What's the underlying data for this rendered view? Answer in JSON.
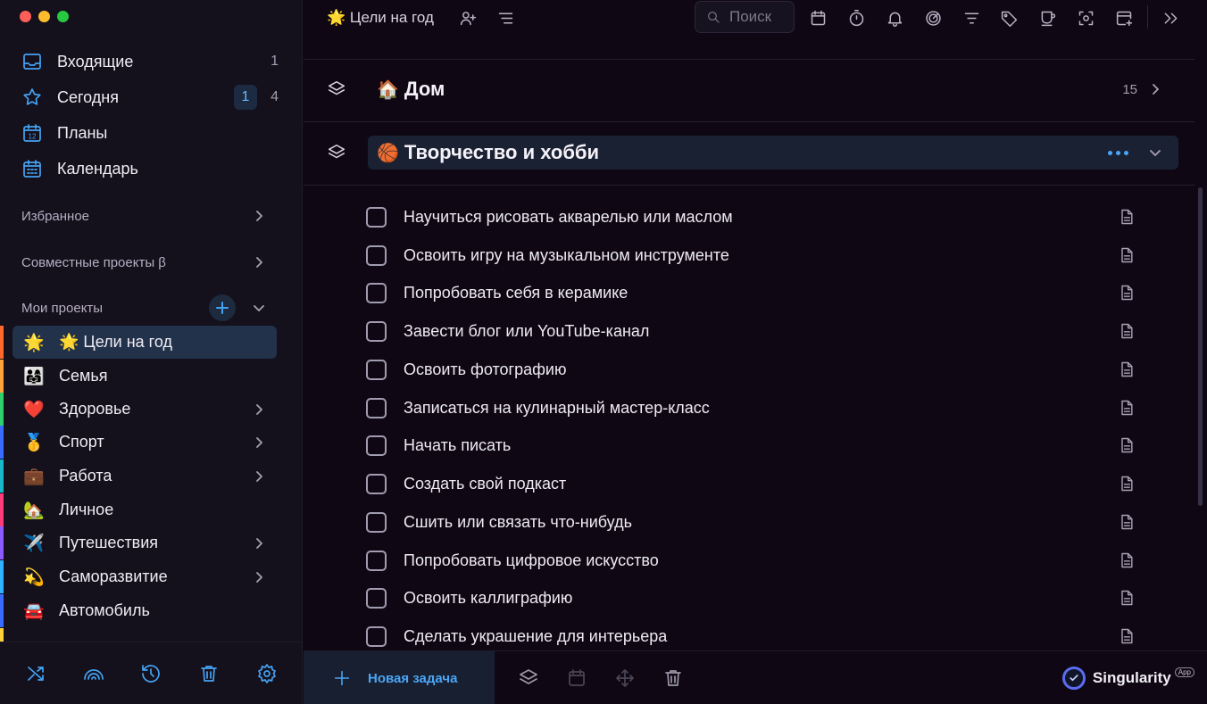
{
  "window": {
    "traffic_lights": [
      "#ff5f57",
      "#febc2e",
      "#28c840"
    ]
  },
  "sidebar": {
    "nav": [
      {
        "label": "Входящие",
        "icon": "inbox-icon",
        "count": "1"
      },
      {
        "label": "Сегодня",
        "icon": "star-icon",
        "badge": "1",
        "count": "4"
      },
      {
        "label": "Планы",
        "icon": "calendar-12-icon",
        "icon_text": "12"
      },
      {
        "label": "Календарь",
        "icon": "calendar-grid-icon"
      }
    ],
    "favorites_label": "Избранное",
    "shared_label": "Совместные проекты β",
    "my_projects_label": "Мои проекты",
    "projects": [
      {
        "emoji": "🌟",
        "label": "🌟 Цели на год",
        "color": "#ff6a2a",
        "active": true
      },
      {
        "emoji": "👨‍👩‍👧",
        "label": "Семья",
        "color": "#ffa23a"
      },
      {
        "emoji": "❤️",
        "label": "Здоровье",
        "color": "#2fcf6b",
        "has_children": true
      },
      {
        "emoji": "🥇",
        "label": "Спорт",
        "color": "#3a6bff",
        "has_children": true
      },
      {
        "emoji": "💼",
        "label": "Работа",
        "color": "#19b8c9",
        "has_children": true
      },
      {
        "emoji": "🏡",
        "label": "Личное",
        "color": "#ff3b7a"
      },
      {
        "emoji": "✈️",
        "label": "Путешествия",
        "color": "#8a5bff",
        "has_children": true
      },
      {
        "emoji": "💫",
        "label": "Саморазвитие",
        "color": "#2fb3ff",
        "has_children": true
      },
      {
        "emoji": "🚘",
        "label": "Автомобиль",
        "color": "#3a6bff"
      }
    ],
    "bottom_icons": [
      "shuffle-icon",
      "rainbow-icon",
      "history-icon",
      "trash-icon",
      "gear-icon"
    ]
  },
  "toolbar": {
    "title": "🌟 Цели на год",
    "search_placeholder": "Поиск",
    "icons": [
      "calendar-icon",
      "timer-icon",
      "bell-icon",
      "focus-icon",
      "filter-icon",
      "tag-icon",
      "cup-icon",
      "scan-icon",
      "add-window-icon",
      "double-chevron-right-icon"
    ]
  },
  "groups": [
    {
      "emoji": "🏠",
      "title": "Дом",
      "count": "15",
      "expanded": false
    },
    {
      "emoji": "🏀",
      "title": "Творчество и хобби",
      "expanded": true
    }
  ],
  "tasks": [
    "Научиться рисовать акварелью или маслом",
    "Освоить игру на музыкальном инструменте",
    "Попробовать себя в керамике",
    "Завести блог или YouTube-канал",
    "Освоить фотографию",
    "Записаться на кулинарный мастер-класс",
    "Начать писать",
    "Создать свой подкаст",
    "Сшить или связать что-нибудь",
    "Попробовать цифровое искусство",
    "Освоить каллиграфию",
    "Сделать украшение для интерьера"
  ],
  "bottom_bar": {
    "new_task_label": "Новая задача",
    "icons": [
      "layers-icon",
      "calendar-icon",
      "move-icon",
      "trash-icon"
    ],
    "brand_name": "Singularity",
    "brand_tag": "App"
  },
  "colors": {
    "accent": "#45a2f2",
    "background": "#0f0814",
    "sidebar": "#14101c",
    "active_item": "#22324a"
  }
}
